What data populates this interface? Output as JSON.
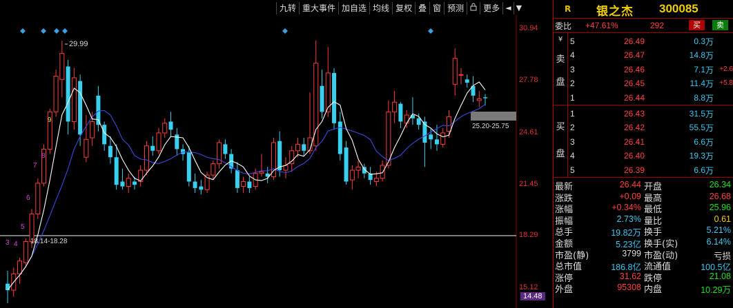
{
  "toolbar": {
    "items": [
      "九转",
      "重大事件",
      "加自选",
      "均线",
      "复权",
      "叠",
      "窗",
      "预测",
      "更多"
    ],
    "lock_icon": "lock-icon",
    "arrows": [
      "◄",
      "▼"
    ]
  },
  "chart": {
    "price_labels": [
      "30.94",
      "27.78",
      "24.61",
      "21.45",
      "18.29",
      "15.12"
    ],
    "current_price": "14.48",
    "annotations": {
      "high": "29.99",
      "box_high": "25.20-25.75",
      "box_low": "18.14-18.28"
    },
    "nine_turn_labels": [
      "3",
      "4",
      "5",
      "6",
      "7",
      "8",
      "9"
    ],
    "colors": {
      "up": "#ff3b3b",
      "down": "#39d0f0",
      "ma5": "#ffffff",
      "ma10": "#3a4ae0",
      "diamond": "#3aa0e0",
      "label9": "#e0d020",
      "box": "#7a7a7a"
    }
  },
  "chart_data": {
    "type": "candlestick",
    "ylim": [
      13.5,
      32.5
    ],
    "series": [
      {
        "o": 15.0,
        "h": 15.8,
        "l": 13.8,
        "c": 14.6
      },
      {
        "o": 14.6,
        "h": 16.0,
        "l": 14.2,
        "c": 15.6
      },
      {
        "o": 15.6,
        "h": 16.6,
        "l": 15.0,
        "c": 16.4
      },
      {
        "o": 16.3,
        "h": 17.8,
        "l": 16.0,
        "c": 17.6
      },
      {
        "o": 17.6,
        "h": 19.6,
        "l": 17.2,
        "c": 19.3
      },
      {
        "o": 19.3,
        "h": 21.5,
        "l": 19.0,
        "c": 21.2
      },
      {
        "o": 21.2,
        "h": 23.6,
        "l": 21.0,
        "c": 23.3
      },
      {
        "o": 23.3,
        "h": 25.8,
        "l": 23.0,
        "c": 25.6
      },
      {
        "o": 25.6,
        "h": 28.2,
        "l": 25.3,
        "c": 27.8
      },
      {
        "o": 27.6,
        "h": 29.99,
        "l": 26.5,
        "c": 29.2
      },
      {
        "o": 28.4,
        "h": 28.8,
        "l": 24.2,
        "c": 25.0
      },
      {
        "o": 25.0,
        "h": 28.3,
        "l": 24.5,
        "c": 27.7
      },
      {
        "o": 27.5,
        "h": 27.9,
        "l": 23.5,
        "c": 24.2
      },
      {
        "o": 22.8,
        "h": 25.4,
        "l": 22.5,
        "c": 23.9
      },
      {
        "o": 24.0,
        "h": 25.6,
        "l": 23.5,
        "c": 25.0
      },
      {
        "o": 26.6,
        "h": 27.2,
        "l": 24.4,
        "c": 24.8
      },
      {
        "o": 24.8,
        "h": 25.0,
        "l": 23.2,
        "c": 23.6
      },
      {
        "o": 23.5,
        "h": 24.1,
        "l": 22.4,
        "c": 22.8
      },
      {
        "o": 22.8,
        "h": 23.6,
        "l": 20.8,
        "c": 21.1
      },
      {
        "o": 21.3,
        "h": 22.1,
        "l": 20.8,
        "c": 21.0
      },
      {
        "o": 21.0,
        "h": 21.8,
        "l": 20.6,
        "c": 21.5
      },
      {
        "o": 21.3,
        "h": 21.6,
        "l": 20.8,
        "c": 21.1
      },
      {
        "o": 21.3,
        "h": 22.3,
        "l": 21.0,
        "c": 22.0
      },
      {
        "o": 22.0,
        "h": 23.8,
        "l": 21.7,
        "c": 23.5
      },
      {
        "o": 23.5,
        "h": 24.1,
        "l": 22.9,
        "c": 23.2
      },
      {
        "o": 23.2,
        "h": 24.6,
        "l": 23.0,
        "c": 24.3
      },
      {
        "o": 24.3,
        "h": 25.2,
        "l": 24.0,
        "c": 24.9
      },
      {
        "o": 25.0,
        "h": 25.6,
        "l": 24.1,
        "c": 24.5
      },
      {
        "o": 24.2,
        "h": 24.6,
        "l": 22.9,
        "c": 23.3
      },
      {
        "o": 23.3,
        "h": 23.6,
        "l": 22.6,
        "c": 23.0
      },
      {
        "o": 23.1,
        "h": 23.5,
        "l": 21.0,
        "c": 21.3
      },
      {
        "o": 21.3,
        "h": 21.8,
        "l": 20.6,
        "c": 20.9
      },
      {
        "o": 21.0,
        "h": 21.4,
        "l": 20.5,
        "c": 20.8
      },
      {
        "o": 20.8,
        "h": 21.9,
        "l": 20.6,
        "c": 21.7
      },
      {
        "o": 21.7,
        "h": 22.6,
        "l": 21.4,
        "c": 22.4
      },
      {
        "o": 22.4,
        "h": 23.9,
        "l": 22.1,
        "c": 23.7
      },
      {
        "o": 23.6,
        "h": 23.9,
        "l": 22.7,
        "c": 23.0
      },
      {
        "o": 23.0,
        "h": 23.3,
        "l": 21.8,
        "c": 22.1
      },
      {
        "o": 22.0,
        "h": 22.5,
        "l": 20.6,
        "c": 20.9
      },
      {
        "o": 21.0,
        "h": 21.6,
        "l": 20.6,
        "c": 21.3
      },
      {
        "o": 21.3,
        "h": 21.6,
        "l": 20.6,
        "c": 20.9
      },
      {
        "o": 21.0,
        "h": 22.1,
        "l": 20.8,
        "c": 21.8
      },
      {
        "o": 21.8,
        "h": 23.0,
        "l": 21.6,
        "c": 21.9
      },
      {
        "o": 21.8,
        "h": 22.2,
        "l": 21.2,
        "c": 21.6
      },
      {
        "o": 21.6,
        "h": 24.0,
        "l": 21.4,
        "c": 23.7
      },
      {
        "o": 23.8,
        "h": 24.4,
        "l": 21.6,
        "c": 22.0
      },
      {
        "o": 22.0,
        "h": 22.8,
        "l": 21.5,
        "c": 22.3
      },
      {
        "o": 22.4,
        "h": 23.5,
        "l": 21.9,
        "c": 23.2
      },
      {
        "o": 23.2,
        "h": 24.0,
        "l": 22.8,
        "c": 23.6
      },
      {
        "o": 23.6,
        "h": 24.0,
        "l": 22.9,
        "c": 23.2
      },
      {
        "o": 23.2,
        "h": 26.8,
        "l": 23.0,
        "c": 24.0
      },
      {
        "o": 23.5,
        "h": 30.0,
        "l": 23.2,
        "c": 28.6
      },
      {
        "o": 27.2,
        "h": 28.2,
        "l": 25.2,
        "c": 25.6
      },
      {
        "o": 25.6,
        "h": 29.6,
        "l": 25.3,
        "c": 28.0
      },
      {
        "o": 28.0,
        "h": 28.3,
        "l": 24.5,
        "c": 24.9
      },
      {
        "o": 25.0,
        "h": 25.6,
        "l": 22.6,
        "c": 23.0
      },
      {
        "o": 23.4,
        "h": 23.8,
        "l": 21.1,
        "c": 21.3
      },
      {
        "o": 21.4,
        "h": 22.3,
        "l": 20.8,
        "c": 22.0
      },
      {
        "o": 22.0,
        "h": 22.6,
        "l": 21.5,
        "c": 22.2
      },
      {
        "o": 22.2,
        "h": 22.4,
        "l": 21.5,
        "c": 21.8
      },
      {
        "o": 21.8,
        "h": 22.2,
        "l": 21.1,
        "c": 21.4
      },
      {
        "o": 21.3,
        "h": 21.9,
        "l": 21.0,
        "c": 21.5
      },
      {
        "o": 21.5,
        "h": 22.6,
        "l": 21.3,
        "c": 22.3
      },
      {
        "o": 22.3,
        "h": 26.3,
        "l": 22.1,
        "c": 25.6
      },
      {
        "o": 25.6,
        "h": 26.9,
        "l": 24.9,
        "c": 26.2
      },
      {
        "o": 26.1,
        "h": 26.2,
        "l": 24.6,
        "c": 25.0
      },
      {
        "o": 24.9,
        "h": 25.7,
        "l": 24.6,
        "c": 25.4
      },
      {
        "o": 25.4,
        "h": 26.5,
        "l": 24.8,
        "c": 25.2
      },
      {
        "o": 25.2,
        "h": 25.5,
        "l": 24.5,
        "c": 24.8
      },
      {
        "o": 25.0,
        "h": 25.3,
        "l": 22.2,
        "c": 23.7
      },
      {
        "o": 24.2,
        "h": 24.6,
        "l": 23.3,
        "c": 23.9
      },
      {
        "o": 23.9,
        "h": 24.8,
        "l": 23.2,
        "c": 23.6
      },
      {
        "o": 23.6,
        "h": 24.6,
        "l": 23.4,
        "c": 24.3
      },
      {
        "o": 24.4,
        "h": 25.7,
        "l": 24.0,
        "c": 25.3
      },
      {
        "o": 27.3,
        "h": 29.5,
        "l": 26.6,
        "c": 28.9
      },
      {
        "o": 27.9,
        "h": 28.3,
        "l": 27.3,
        "c": 27.9
      },
      {
        "o": 27.6,
        "h": 27.9,
        "l": 27.1,
        "c": 27.4
      },
      {
        "o": 27.2,
        "h": 27.8,
        "l": 26.2,
        "c": 26.6
      },
      {
        "o": 26.3,
        "h": 26.9,
        "l": 25.9,
        "c": 26.4
      },
      {
        "o": 26.5,
        "h": 26.7,
        "l": 26.0,
        "c": 26.44
      }
    ]
  },
  "quote": {
    "market_tag": "R",
    "name": "银之杰",
    "code": "300085",
    "ratio_label": "委比",
    "ratio_value": "+47.61%",
    "ratio_diff": "292",
    "sell_btn": "买",
    "buy_btn": "卖",
    "ask_label": [
      "¥",
      "卖",
      "盘"
    ],
    "bid_label": [
      "买",
      "盘"
    ],
    "asks": [
      {
        "level": "5",
        "price": "26.49",
        "vol": "0.3",
        "unit": "万",
        "chg": ""
      },
      {
        "level": "4",
        "price": "26.47",
        "vol": "14.8",
        "unit": "万",
        "chg": ""
      },
      {
        "level": "3",
        "price": "26.46",
        "vol": "7.1",
        "unit": "万",
        "chg": "+2.6"
      },
      {
        "level": "2",
        "price": "26.45",
        "vol": "11.4",
        "unit": "万",
        "chg": "+5.8"
      },
      {
        "level": "1",
        "price": "26.44",
        "vol": "8.8",
        "unit": "万",
        "chg": ""
      }
    ],
    "bids": [
      {
        "level": "1",
        "price": "26.43",
        "vol": "31.5",
        "unit": "万"
      },
      {
        "level": "2",
        "price": "26.42",
        "vol": "55.5",
        "unit": "万"
      },
      {
        "level": "3",
        "price": "26.41",
        "vol": "6.6",
        "unit": "万"
      },
      {
        "level": "4",
        "price": "26.40",
        "vol": "19.3",
        "unit": "万"
      },
      {
        "level": "5",
        "price": "26.39",
        "vol": "6.6",
        "unit": "万"
      }
    ],
    "stats": [
      {
        "l1": "最新",
        "v1": "26.44",
        "c1": "c-red",
        "l2": "开盘",
        "v2": "26.34",
        "c2": "c-green"
      },
      {
        "l1": "涨跌",
        "v1": "+0.09",
        "c1": "c-red",
        "l2": "最高",
        "v2": "26.68",
        "c2": "c-red"
      },
      {
        "l1": "涨幅",
        "v1": "+0.34%",
        "c1": "c-red",
        "l2": "最低",
        "v2": "25.96",
        "c2": "c-green"
      },
      {
        "l1": "振幅",
        "v1": "2.73%",
        "c1": "c-cyan",
        "l2": "量比",
        "v2": "0.61",
        "c2": "c-yellow"
      },
      {
        "l1": "总手",
        "v1": "19.82万",
        "c1": "c-cyan",
        "l2": "换手",
        "v2": "5.21%",
        "c2": "c-cyan"
      },
      {
        "l1": "金额",
        "v1": "5.23亿",
        "c1": "c-cyan",
        "l2": "换手(实)",
        "v2": "6.14%",
        "c2": "c-cyan"
      },
      {
        "l1": "市盈(静)",
        "v1": "3799",
        "c1": "c-white",
        "l2": "市盈(动)",
        "v2": "亏损",
        "c2": "c-white"
      },
      {
        "l1": "总市值",
        "v1": "186.8亿",
        "c1": "c-cyan",
        "l2": "流通值",
        "v2": "100.5亿",
        "c2": "c-cyan"
      },
      {
        "l1": "涨停",
        "v1": "31.62",
        "c1": "c-red",
        "l2": "跌停",
        "v2": "21.08",
        "c2": "c-green"
      },
      {
        "l1": "外盘",
        "v1": "95308",
        "c1": "c-red",
        "l2": "内盘",
        "v2": "10.29万",
        "c2": "c-green"
      }
    ]
  }
}
